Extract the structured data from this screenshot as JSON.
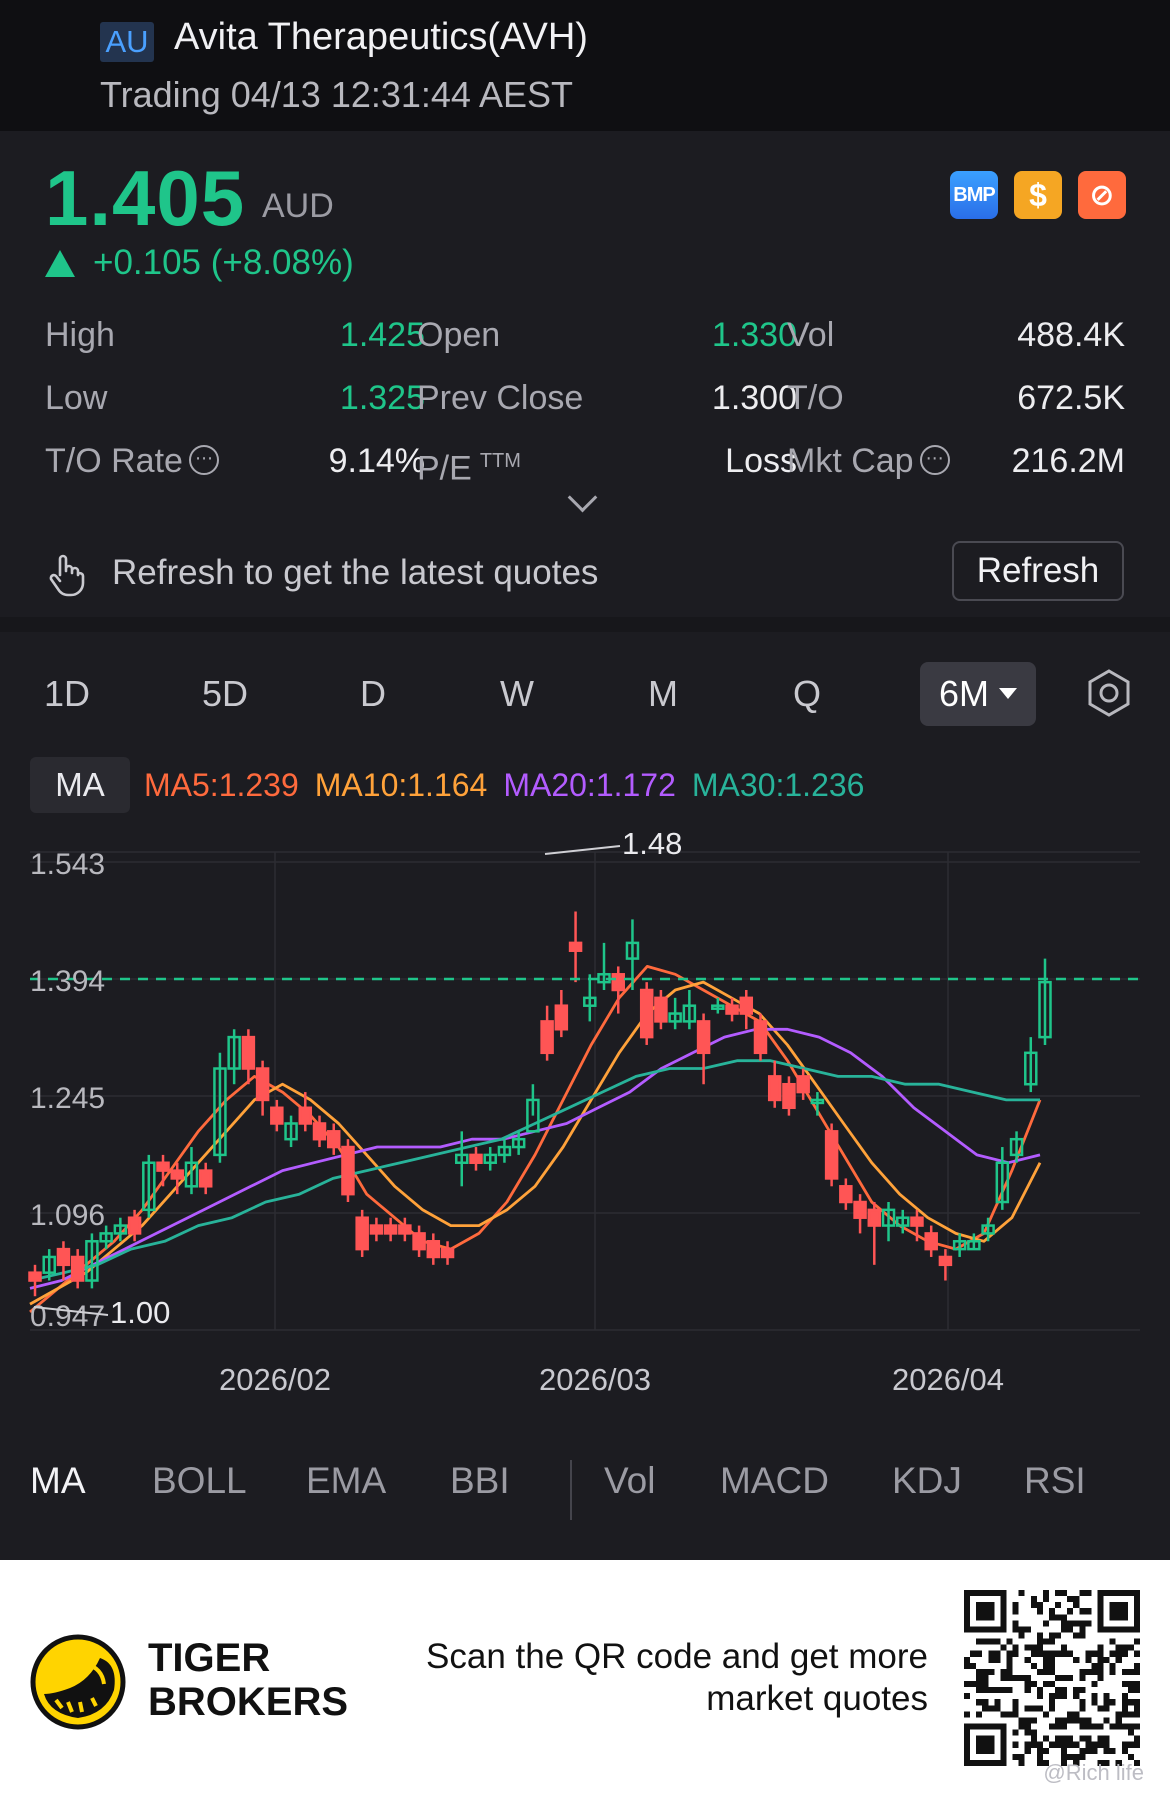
{
  "header": {
    "market": "AU",
    "name": "Avita Therapeutics(AVH)",
    "status": "Trading 04/13 12:31:44 AEST"
  },
  "quote": {
    "price": "1.405",
    "currency": "AUD",
    "change": "+0.105 (+8.08%)",
    "icons": [
      "bmp-icon",
      "dollar-icon",
      "ban-icon"
    ],
    "icon_labels": {
      "bmp": "BMP",
      "dollar": "$",
      "ban": "⊘"
    },
    "stats": [
      [
        {
          "label": "High",
          "value": "1.425",
          "green": true
        },
        {
          "label": "Open",
          "value": "1.330",
          "green": true
        },
        {
          "label": "Vol",
          "value": "488.4K"
        }
      ],
      [
        {
          "label": "Low",
          "value": "1.325",
          "green": true
        },
        {
          "label": "Prev Close",
          "value": "1.300"
        },
        {
          "label": "T/O",
          "value": "672.5K"
        }
      ],
      [
        {
          "label": "T/O Rate",
          "value": "9.14%"
        },
        {
          "label": "P/E",
          "value": "Loss"
        },
        {
          "label": "Mkt Cap",
          "value": "216.2M"
        }
      ]
    ],
    "pe_suffix": "TTM",
    "refresh_text": "Refresh to get the latest quotes",
    "refresh_button": "Refresh"
  },
  "chart": {
    "periods": [
      "1D",
      "5D",
      "D",
      "W",
      "M",
      "Q"
    ],
    "active_period": "6M",
    "ma_chip": "MA",
    "ma_values": [
      {
        "label": "MA5:1.239",
        "color": "#ff6a3d"
      },
      {
        "label": "MA10:1.164",
        "color": "#ffa23a"
      },
      {
        "label": "MA20:1.172",
        "color": "#b35cff"
      },
      {
        "label": "MA30:1.236",
        "color": "#28b39a"
      }
    ],
    "y_ticks": [
      "1.543",
      "1.394",
      "1.245",
      "1.096",
      "0.947"
    ],
    "x_ticks": [
      "2026/02",
      "2026/03",
      "2026/04"
    ],
    "high_label": "1.48",
    "low_label": "1.00",
    "indicators_main": [
      "MA",
      "BOLL",
      "EMA",
      "BBI"
    ],
    "indicators_sub": [
      "Vol",
      "MACD",
      "KDJ",
      "RSI"
    ]
  },
  "chart_data": {
    "type": "candlestick",
    "ylim": [
      0.947,
      1.543
    ],
    "y_ticks": [
      1.543,
      1.394,
      1.245,
      1.096,
      0.947
    ],
    "x_tick_labels": [
      "2026/02",
      "2026/03",
      "2026/04"
    ],
    "current_price_line": 1.394,
    "colors": {
      "up": "#1fc58a",
      "down": "#ff5555"
    },
    "candles": [
      [
        1.02,
        1.01,
        1.03,
        0.99
      ],
      [
        1.02,
        1.04,
        1.05,
        1.01
      ],
      [
        1.05,
        1.03,
        1.06,
        1.01
      ],
      [
        1.04,
        1.01,
        1.05,
        1.0
      ],
      [
        1.01,
        1.06,
        1.07,
        1.0
      ],
      [
        1.06,
        1.07,
        1.08,
        1.05
      ],
      [
        1.07,
        1.08,
        1.09,
        1.06
      ],
      [
        1.09,
        1.07,
        1.1,
        1.06
      ],
      [
        1.1,
        1.16,
        1.17,
        1.09
      ],
      [
        1.16,
        1.15,
        1.17,
        1.13
      ],
      [
        1.15,
        1.14,
        1.16,
        1.12
      ],
      [
        1.13,
        1.16,
        1.18,
        1.12
      ],
      [
        1.15,
        1.13,
        1.16,
        1.12
      ],
      [
        1.17,
        1.28,
        1.3,
        1.16
      ],
      [
        1.28,
        1.32,
        1.33,
        1.26
      ],
      [
        1.32,
        1.28,
        1.33,
        1.26
      ],
      [
        1.28,
        1.24,
        1.29,
        1.22
      ],
      [
        1.23,
        1.21,
        1.24,
        1.2
      ],
      [
        1.19,
        1.21,
        1.22,
        1.18
      ],
      [
        1.23,
        1.21,
        1.25,
        1.2
      ],
      [
        1.21,
        1.19,
        1.22,
        1.18
      ],
      [
        1.2,
        1.18,
        1.21,
        1.17
      ],
      [
        1.18,
        1.12,
        1.19,
        1.11
      ],
      [
        1.09,
        1.05,
        1.1,
        1.04
      ],
      [
        1.08,
        1.07,
        1.09,
        1.06
      ],
      [
        1.08,
        1.07,
        1.09,
        1.06
      ],
      [
        1.08,
        1.07,
        1.09,
        1.06
      ],
      [
        1.07,
        1.05,
        1.08,
        1.04
      ],
      [
        1.06,
        1.04,
        1.07,
        1.03
      ],
      [
        1.05,
        1.04,
        1.06,
        1.03
      ],
      [
        1.16,
        1.17,
        1.2,
        1.13
      ],
      [
        1.17,
        1.16,
        1.18,
        1.15
      ],
      [
        1.16,
        1.17,
        1.18,
        1.15
      ],
      [
        1.17,
        1.18,
        1.19,
        1.16
      ],
      [
        1.18,
        1.19,
        1.2,
        1.17
      ],
      [
        1.2,
        1.24,
        1.26,
        1.22
      ],
      [
        1.34,
        1.3,
        1.36,
        1.29
      ],
      [
        1.36,
        1.33,
        1.38,
        1.32
      ],
      [
        1.44,
        1.43,
        1.48,
        1.39
      ],
      [
        1.36,
        1.37,
        1.4,
        1.34
      ],
      [
        1.39,
        1.4,
        1.44,
        1.38
      ],
      [
        1.4,
        1.38,
        1.41,
        1.35
      ],
      [
        1.42,
        1.44,
        1.47,
        1.38
      ],
      [
        1.38,
        1.32,
        1.39,
        1.31
      ],
      [
        1.37,
        1.34,
        1.38,
        1.33
      ],
      [
        1.34,
        1.35,
        1.37,
        1.33
      ],
      [
        1.34,
        1.36,
        1.38,
        1.33
      ],
      [
        1.34,
        1.3,
        1.35,
        1.26
      ],
      [
        1.36,
        1.36,
        1.37,
        1.35
      ],
      [
        1.36,
        1.35,
        1.37,
        1.34
      ],
      [
        1.37,
        1.35,
        1.38,
        1.33
      ],
      [
        1.34,
        1.3,
        1.35,
        1.29
      ],
      [
        1.27,
        1.24,
        1.29,
        1.23
      ],
      [
        1.26,
        1.23,
        1.27,
        1.22
      ],
      [
        1.27,
        1.25,
        1.28,
        1.24
      ],
      [
        1.24,
        1.24,
        1.25,
        1.22
      ],
      [
        1.2,
        1.14,
        1.21,
        1.13
      ],
      [
        1.13,
        1.11,
        1.14,
        1.1
      ],
      [
        1.11,
        1.09,
        1.12,
        1.07
      ],
      [
        1.1,
        1.08,
        1.11,
        1.03
      ],
      [
        1.08,
        1.1,
        1.11,
        1.06
      ],
      [
        1.08,
        1.09,
        1.1,
        1.07
      ],
      [
        1.09,
        1.08,
        1.1,
        1.06
      ],
      [
        1.07,
        1.05,
        1.08,
        1.04
      ],
      [
        1.04,
        1.03,
        1.05,
        1.01
      ],
      [
        1.05,
        1.06,
        1.07,
        1.04
      ],
      [
        1.05,
        1.06,
        1.07,
        1.05
      ],
      [
        1.07,
        1.08,
        1.09,
        1.06
      ],
      [
        1.11,
        1.16,
        1.18,
        1.1
      ],
      [
        1.17,
        1.19,
        1.2,
        1.16
      ],
      [
        1.26,
        1.3,
        1.32,
        1.25
      ],
      [
        1.32,
        1.39,
        1.42,
        1.31
      ]
    ],
    "series": [
      {
        "name": "MA5",
        "color": "#ff6a3d",
        "values": [
          0.97,
          1.0,
          1.03,
          1.06,
          1.1,
          1.15,
          1.2,
          1.24,
          1.27,
          1.25,
          1.22,
          1.18,
          1.12,
          1.09,
          1.06,
          1.05,
          1.07,
          1.11,
          1.17,
          1.24,
          1.31,
          1.37,
          1.41,
          1.4,
          1.38,
          1.36,
          1.34,
          1.29,
          1.23,
          1.17,
          1.11,
          1.08,
          1.06,
          1.05,
          1.07,
          1.15,
          1.24
        ]
      },
      {
        "name": "MA10",
        "color": "#ffa23a",
        "values": [
          0.98,
          1.0,
          1.02,
          1.05,
          1.08,
          1.12,
          1.16,
          1.2,
          1.24,
          1.26,
          1.24,
          1.21,
          1.17,
          1.13,
          1.1,
          1.08,
          1.08,
          1.1,
          1.13,
          1.18,
          1.24,
          1.3,
          1.35,
          1.38,
          1.39,
          1.37,
          1.35,
          1.31,
          1.26,
          1.21,
          1.16,
          1.12,
          1.09,
          1.07,
          1.06,
          1.09,
          1.16
        ]
      },
      {
        "name": "MA20",
        "color": "#b35cff",
        "values": [
          1.0,
          1.01,
          1.03,
          1.05,
          1.07,
          1.09,
          1.11,
          1.13,
          1.15,
          1.16,
          1.17,
          1.18,
          1.18,
          1.18,
          1.19,
          1.19,
          1.2,
          1.21,
          1.23,
          1.25,
          1.28,
          1.3,
          1.32,
          1.33,
          1.33,
          1.32,
          1.3,
          1.27,
          1.23,
          1.2,
          1.17,
          1.16,
          1.17
        ]
      },
      {
        "name": "MA30",
        "color": "#28b39a",
        "values": [
          1.01,
          1.02,
          1.03,
          1.05,
          1.06,
          1.08,
          1.09,
          1.11,
          1.12,
          1.14,
          1.15,
          1.16,
          1.17,
          1.18,
          1.19,
          1.21,
          1.23,
          1.25,
          1.27,
          1.28,
          1.28,
          1.29,
          1.29,
          1.28,
          1.27,
          1.27,
          1.26,
          1.26,
          1.25,
          1.24,
          1.24
        ]
      }
    ]
  },
  "footer": {
    "brand_line1": "TIGER",
    "brand_line2": "BROKERS",
    "scan_line1": "Scan the QR code and get more",
    "scan_line2": "market quotes",
    "watermark": "@Rich life"
  }
}
